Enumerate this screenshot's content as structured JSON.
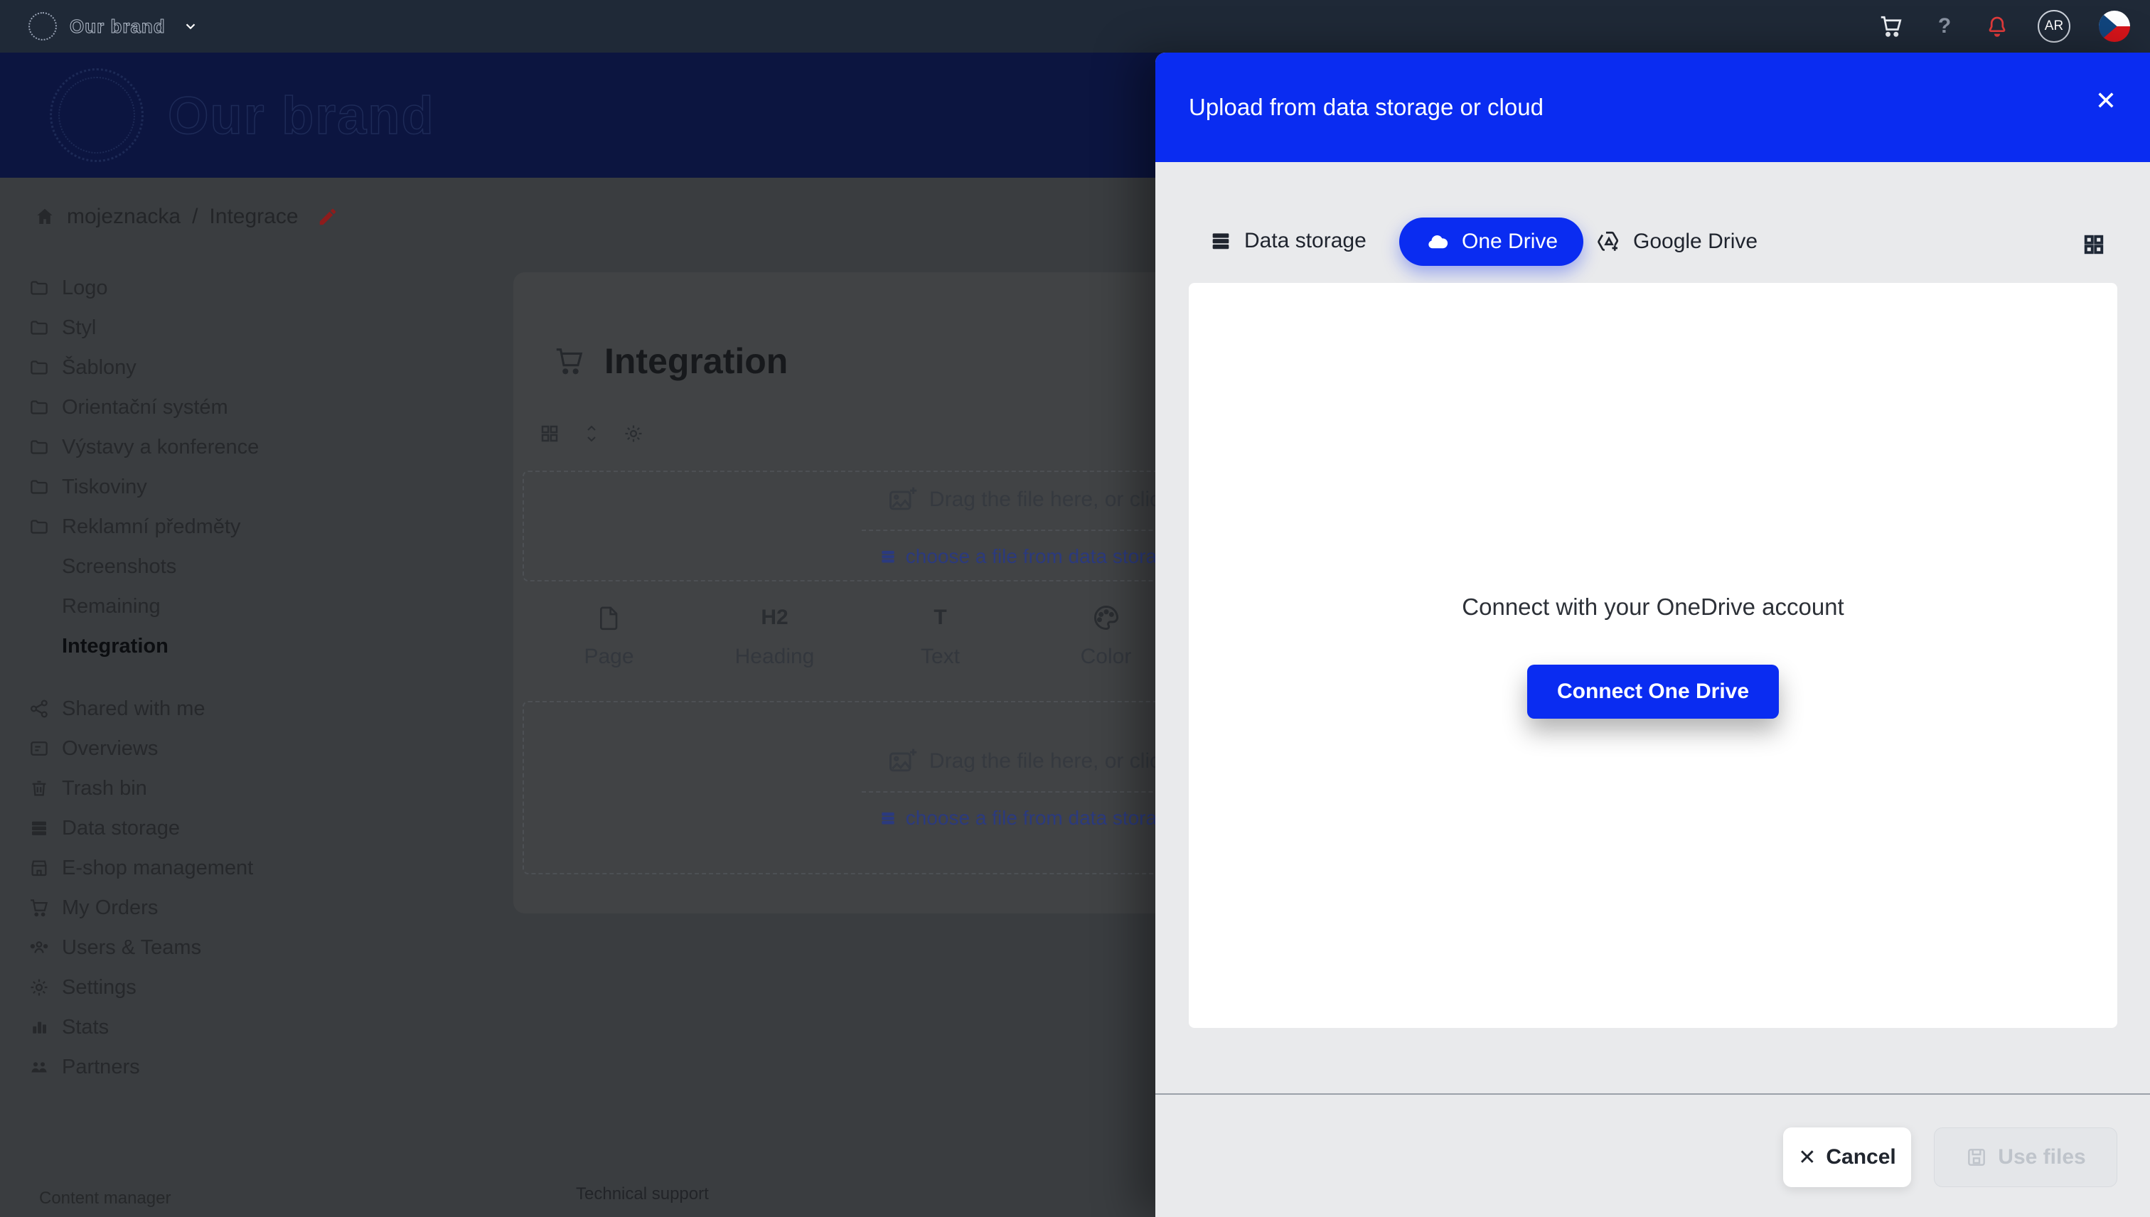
{
  "navbar": {
    "brand": "Our brand",
    "help_label": "?",
    "avatar_initials": "AR"
  },
  "hero": {
    "brand": "Our brand"
  },
  "breadcrumb": {
    "project": "mojeznacka",
    "separator": "/",
    "current": "Integrace"
  },
  "sidebar": {
    "folders": [
      "Logo",
      "Styl",
      "Šablony",
      "Orientační systém",
      "Výstavy a konference",
      "Tiskoviny",
      "Reklamní předměty"
    ],
    "subpages": [
      "Screenshots",
      "Remaining",
      "Integration"
    ],
    "menu": [
      "Shared with me",
      "Overviews",
      "Trash bin",
      "Data storage",
      "E-shop management",
      "My Orders",
      "Users & Teams",
      "Settings",
      "Stats",
      "Partners"
    ]
  },
  "main": {
    "title": "Integration",
    "dropzone": {
      "drag_text": "Drag the file here, or click",
      "choose_link": "choose a file from data storage"
    },
    "elements": [
      {
        "label": "Page"
      },
      {
        "label": "Heading",
        "glyph": "H2"
      },
      {
        "label": "Text",
        "glyph": "T"
      },
      {
        "label": "Color"
      }
    ]
  },
  "page_footer": {
    "left": "Content manager",
    "right": "Technical support"
  },
  "modal": {
    "title": "Upload from data storage or cloud",
    "close": "✕",
    "tabs": [
      {
        "label": "Data storage"
      },
      {
        "label": "One Drive",
        "active": true
      },
      {
        "label": "Google Drive"
      }
    ],
    "panel": {
      "message": "Connect with your OneDrive account",
      "connect_button": "Connect One Drive"
    },
    "footer": {
      "cancel": "Cancel",
      "use_files": "Use files"
    }
  },
  "colors": {
    "accent_blue": "#0a2cf1",
    "notification_red": "#e23b3b",
    "flag_blue": "#11457e",
    "flag_red": "#d7141a"
  }
}
